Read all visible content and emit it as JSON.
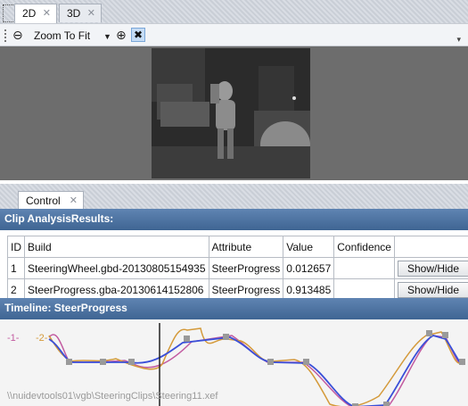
{
  "top_tabs": [
    {
      "label": "2D",
      "active": true
    },
    {
      "label": "3D",
      "active": false
    }
  ],
  "toolbar": {
    "zoom_label": "Zoom To Fit",
    "icons": [
      "zoom-out-icon",
      "dropdown-arrow-icon",
      "zoom-in-icon",
      "fit-icon",
      "overflow-icon"
    ]
  },
  "control_tab": {
    "label": "Control"
  },
  "clip_analysis": {
    "header": "Clip AnalysisResults:",
    "columns": [
      "ID",
      "Build",
      "Attribute",
      "Value",
      "Confidence",
      ""
    ],
    "rows": [
      {
        "id": "1",
        "build": "SteeringWheel.gbd-20130805154935",
        "attribute": "SteerProgress",
        "value": "0.012657",
        "confidence": "",
        "action": "Show/Hide"
      },
      {
        "id": "2",
        "build": "SteerProgress.gba-20130614152806",
        "attribute": "SteerProgress",
        "value": "0.913485",
        "confidence": "",
        "action": "Show/Hide"
      }
    ]
  },
  "timeline": {
    "header": "Timeline: SteerProgress",
    "labels": [
      "-1-",
      "-2-"
    ],
    "path": "\\\\nuidevtools01\\vgb\\SteeringClips\\Steering11.xef",
    "colors": {
      "series1": "#c25aa0",
      "series2": "#d49a3a",
      "smooth": "#3a4fd8",
      "marker": "#9a9a9a"
    }
  },
  "colors": {
    "header_blue": "#4a6f9e",
    "fit_highlight": "#c5dcf5"
  }
}
